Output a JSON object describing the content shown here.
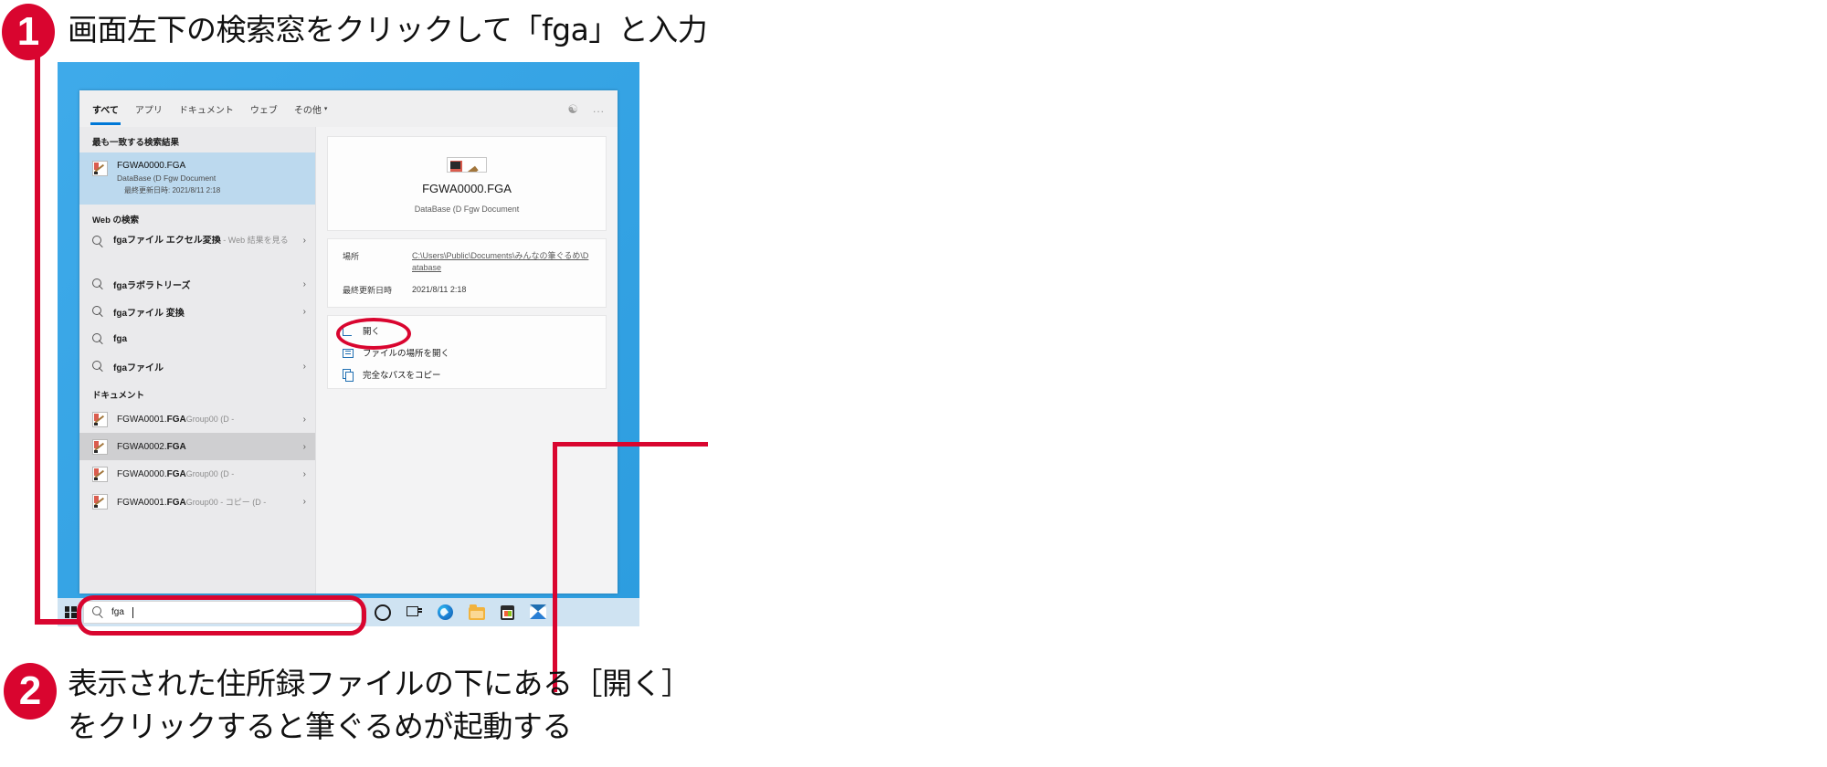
{
  "steps": [
    {
      "number": "1",
      "text": "画面左下の検索窓をクリックして「fga」と入力"
    },
    {
      "number": "2",
      "line1": "表示された住所録ファイルの下にある［開く］",
      "line2": "をクリックすると筆ぐるめが起動する"
    }
  ],
  "colors": {
    "accent_red": "#d9052f",
    "desktop_blue": "#2ea3e8",
    "tab_underline": "#0078d7",
    "selection_blue": "#bcd9ee"
  },
  "search_panel": {
    "tabs": [
      {
        "label": "すべて",
        "active": true
      },
      {
        "label": "アプリ",
        "active": false
      },
      {
        "label": "ドキュメント",
        "active": false
      },
      {
        "label": "ウェブ",
        "active": false
      },
      {
        "label": "その他",
        "active": false,
        "caret": "▾"
      }
    ],
    "header_icons": {
      "feedback": "feedback-icon",
      "more": "..."
    },
    "groups": {
      "best_match_title": "最も一致する検索結果",
      "best_match": {
        "name": "FGWA0000.FGA",
        "type": "DataBase (D Fgw Document",
        "modified": "最終更新日時: 2021/8/11 2:18"
      },
      "web_title": "Web の検索",
      "web_items": [
        {
          "label": "fgaファイル エクセル変換",
          "suffix": " - Web 結果を見る",
          "chevron": "›",
          "wrap": true
        },
        {
          "label": "fgaラボラトリーズ",
          "suffix": "",
          "chevron": "›",
          "wrap": false
        },
        {
          "label": "fgaファイル 変換",
          "suffix": "",
          "chevron": "›",
          "wrap": false
        },
        {
          "label": "fga",
          "suffix": "",
          "chevron": "",
          "wrap": false
        },
        {
          "label": "fgaファイル",
          "suffix": "",
          "chevron": "›",
          "wrap": false
        }
      ],
      "documents_title": "ドキュメント",
      "documents": [
        {
          "name_pre": "FGWA0001.",
          "name_bold": "FGA",
          "dim": "Group00 (D -",
          "chevron": "›",
          "selected": false
        },
        {
          "name_pre": "FGWA0002.",
          "name_bold": "FGA",
          "dim": "",
          "chevron": "›",
          "selected": true
        },
        {
          "name_pre": "FGWA0000.",
          "name_bold": "FGA",
          "dim": "Group00 (D -",
          "chevron": "›",
          "selected": false
        },
        {
          "name_pre": "FGWA0001.",
          "name_bold": "FGA",
          "dim": "Group00 - コピー (D -",
          "chevron": "›",
          "selected": false
        }
      ]
    },
    "detail": {
      "file_name": "FGWA0000.FGA",
      "file_type": "DataBase (D Fgw Document",
      "meta": [
        {
          "key": "場所",
          "value": "C:\\Users\\Public\\Documents\\みんなの筆ぐるめ\\Database",
          "link": true
        },
        {
          "key": "最終更新日時",
          "value": "2021/8/11 2:18",
          "link": false
        }
      ],
      "actions": [
        {
          "label": "開く",
          "icon": "open-icon",
          "highlighted": true
        },
        {
          "label": "ファイルの場所を開く",
          "icon": "folder-icon",
          "highlighted": false
        },
        {
          "label": "完全なパスをコピー",
          "icon": "copy-icon",
          "highlighted": false
        }
      ]
    }
  },
  "taskbar": {
    "start_button": "windows-start-icon",
    "search_query": "fga",
    "search_icon": "magnifier-icon",
    "icons": [
      {
        "name": "cortana-icon"
      },
      {
        "name": "task-view-icon"
      },
      {
        "name": "microsoft-edge-icon"
      },
      {
        "name": "file-explorer-icon"
      },
      {
        "name": "microsoft-store-icon"
      },
      {
        "name": "mail-icon"
      }
    ]
  }
}
